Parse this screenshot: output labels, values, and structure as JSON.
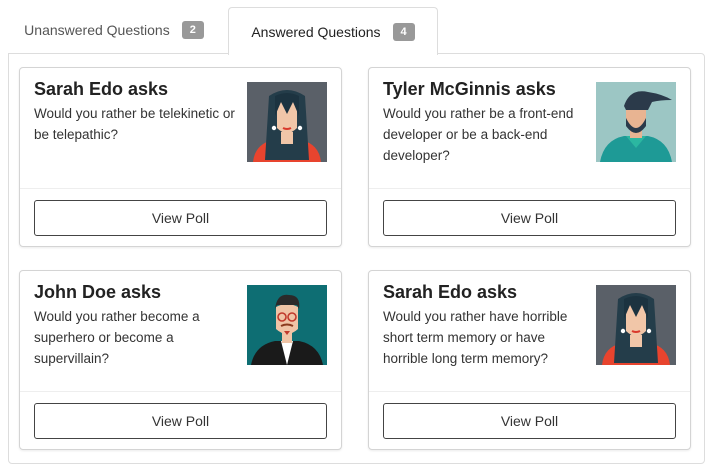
{
  "tabs": [
    {
      "label": "Unanswered Questions",
      "count": "2",
      "active": false
    },
    {
      "label": "Answered Questions",
      "count": "4",
      "active": true
    }
  ],
  "polls": [
    {
      "author_line": "Sarah Edo asks",
      "question": "Would you rather be telekinetic or be telepathic?",
      "avatar": "woman-long-hair-avatar",
      "button": "View Poll"
    },
    {
      "author_line": "Tyler McGinnis asks",
      "question": "Would you rather be a front-end developer or be a back-end developer?",
      "avatar": "man-beard-avatar",
      "button": "View Poll"
    },
    {
      "author_line": "John Doe asks",
      "question": "Would you rather become a superhero or become a supervillain?",
      "avatar": "man-glasses-avatar",
      "button": "View Poll"
    },
    {
      "author_line": "Sarah Edo asks",
      "question": "Would you rather have horrible short term memory or have horrible long term memory?",
      "avatar": "woman-long-hair-avatar",
      "button": "View Poll"
    }
  ],
  "colors": {
    "badge": "#999999",
    "border": "#dddddd",
    "avatar_bg_grey": "#5a6068",
    "avatar_bg_teal": "#9cc6c4",
    "avatar_bg_dark_teal": "#0e6e73"
  }
}
